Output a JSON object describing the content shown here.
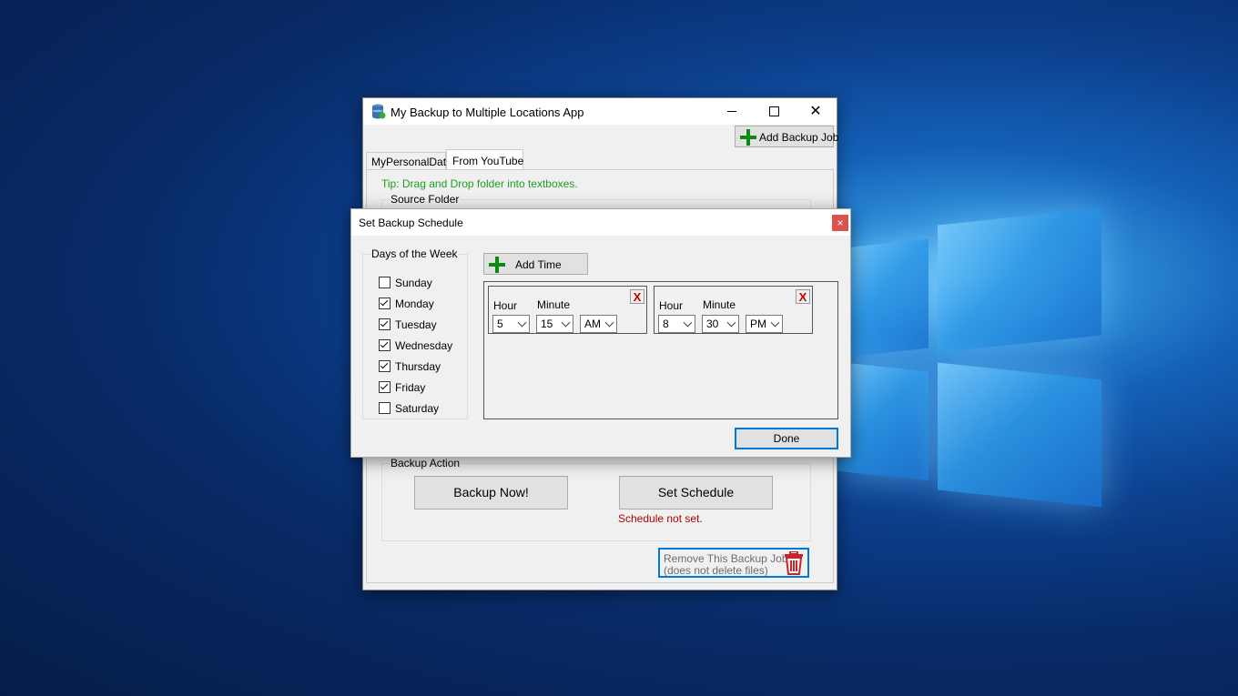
{
  "main_window": {
    "title": "My Backup to Multiple Locations App",
    "add_job_label": "Add Backup Job",
    "tabs": [
      {
        "label": "MyPersonalData",
        "active": false
      },
      {
        "label": "From YouTube",
        "active": true
      }
    ],
    "tip": "Tip: Drag and Drop folder into textboxes.",
    "source_folder_label": "Source Folder",
    "backup_action": {
      "title": "Backup Action",
      "backup_now_label": "Backup Now!",
      "set_schedule_label": "Set Schedule",
      "status": "Schedule not set."
    },
    "remove_job": {
      "line1": "Remove This Backup Job",
      "line2": "(does not delete files)"
    }
  },
  "schedule_dialog": {
    "title": "Set Backup Schedule",
    "close_glyph": "×",
    "days_group_title": "Days of the Week",
    "days": [
      {
        "label": "Sunday",
        "checked": false
      },
      {
        "label": "Monday",
        "checked": true
      },
      {
        "label": "Tuesday",
        "checked": true
      },
      {
        "label": "Wednesday",
        "checked": true
      },
      {
        "label": "Thursday",
        "checked": true
      },
      {
        "label": "Friday",
        "checked": true
      },
      {
        "label": "Saturday",
        "checked": false
      }
    ],
    "add_time_label": "Add Time",
    "hour_label": "Hour",
    "minute_label": "Minute",
    "times": [
      {
        "hour": "5",
        "minute": "15",
        "ampm": "AM"
      },
      {
        "hour": "8",
        "minute": "30",
        "ampm": "PM"
      }
    ],
    "remove_glyph": "X",
    "done_label": "Done"
  },
  "colors": {
    "tip_green": "#1e9e1e",
    "status_red": "#b00000",
    "accent_blue": "#0078d7",
    "plus_green": "#0a8a14"
  }
}
